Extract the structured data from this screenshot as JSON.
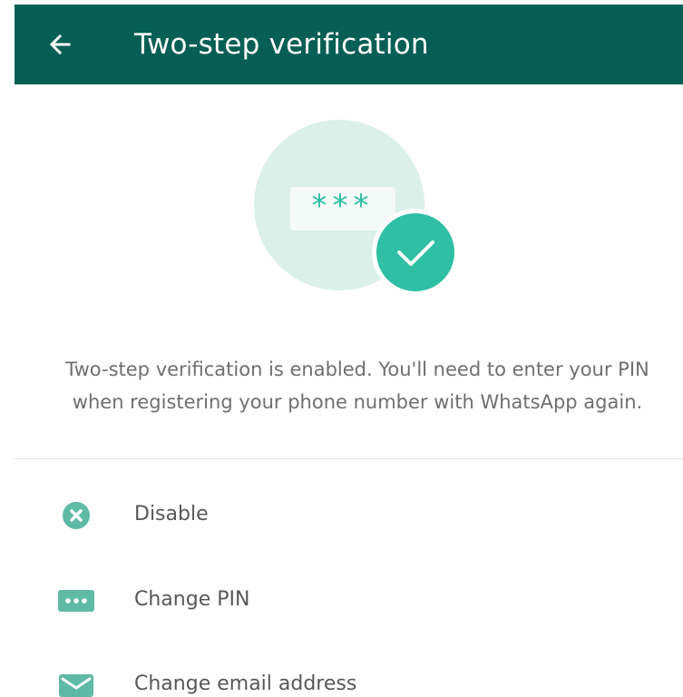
{
  "colors": {
    "app_bar": "#075e54",
    "accent": "#2ebfa4",
    "illustration_circle": "#dcf0ea",
    "icon": "#5ebaa4",
    "text_primary": "#585858",
    "text_secondary": "#6f6f6f"
  },
  "app_bar": {
    "back_icon": "arrow-left-icon",
    "title": "Two-step verification"
  },
  "illustration": {
    "pin_mask": "***",
    "badge_icon": "check-icon"
  },
  "description": "Two-step verification is enabled. You'll need to enter your PIN when registering your phone number with WhatsApp again.",
  "options": [
    {
      "icon": "close-circle-icon",
      "label": "Disable"
    },
    {
      "icon": "pin-dots-icon",
      "label": "Change PIN"
    },
    {
      "icon": "mail-icon",
      "label": "Change email address"
    }
  ]
}
